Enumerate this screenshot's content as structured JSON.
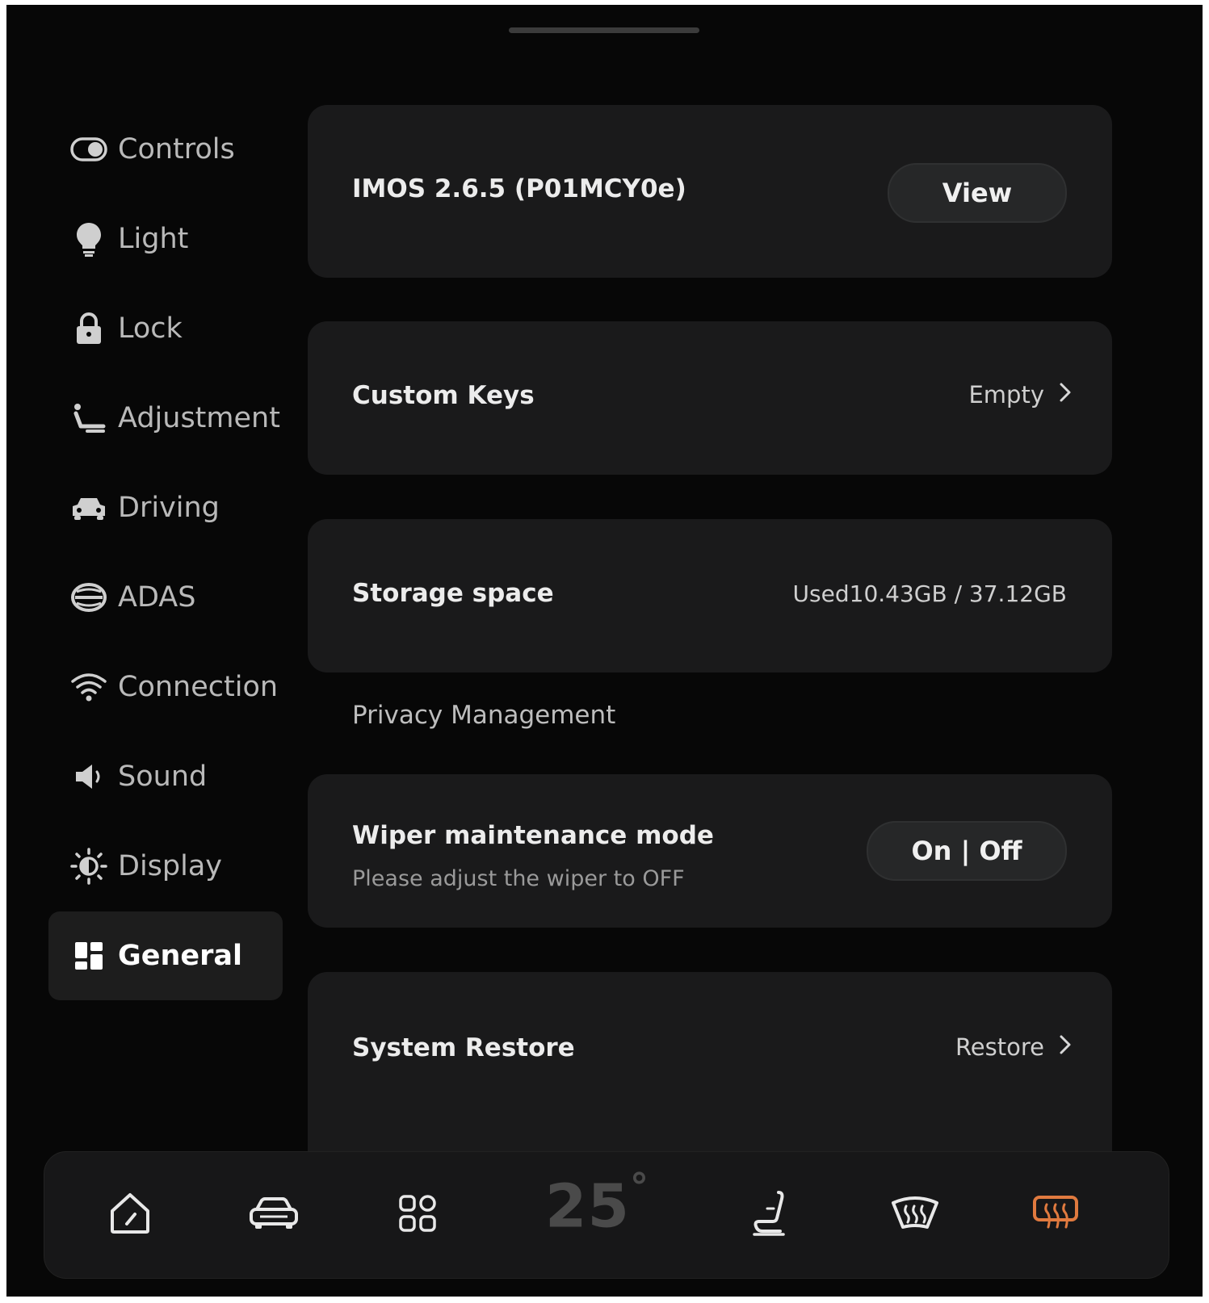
{
  "sidebar": {
    "items": [
      {
        "label": "Controls",
        "icon": "controls-toggle-icon"
      },
      {
        "label": "Light",
        "icon": "bulb-icon"
      },
      {
        "label": "Lock",
        "icon": "lock-icon"
      },
      {
        "label": "Adjustment",
        "icon": "seat-icon"
      },
      {
        "label": "Driving",
        "icon": "car-icon"
      },
      {
        "label": "ADAS",
        "icon": "adas-icon"
      },
      {
        "label": "Connection",
        "icon": "wifi-icon"
      },
      {
        "label": "Sound",
        "icon": "speaker-icon"
      },
      {
        "label": "Display",
        "icon": "brightness-icon"
      },
      {
        "label": "General",
        "icon": "grid-icon",
        "active": true
      }
    ]
  },
  "main": {
    "version": {
      "title": "IMOS 2.6.5 (P01MCY0e)",
      "button": "View"
    },
    "custom_keys": {
      "title": "Custom Keys",
      "value": "Empty"
    },
    "storage": {
      "title": "Storage space",
      "value": "Used10.43GB / 37.12GB"
    },
    "privacy_header": "Privacy Management",
    "wiper": {
      "title": "Wiper maintenance mode",
      "subtitle": "Please adjust the wiper to OFF",
      "toggle": "On | Off"
    },
    "restore": {
      "title": "System Restore",
      "value": "Restore"
    }
  },
  "dock": {
    "temperature": "25",
    "degree": "°",
    "items": [
      "home-icon",
      "vehicle-icon",
      "apps-icon",
      "seat-heat-icon",
      "front-defrost-icon",
      "rear-defrost-icon"
    ],
    "rear_defrost_color": "#e07a3f"
  },
  "colors": {
    "background": "#070707",
    "card": "#1a1a1b",
    "accent": "#e07a3f"
  }
}
